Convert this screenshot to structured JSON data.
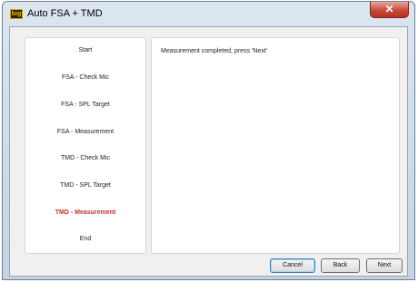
{
  "window": {
    "icon_text": "big",
    "title": "Auto FSA + TMD"
  },
  "steps": [
    {
      "label": "Start",
      "active": false
    },
    {
      "label": "FSA - Check Mic",
      "active": false
    },
    {
      "label": "FSA - SPL Target",
      "active": false
    },
    {
      "label": "FSA - Measurement",
      "active": false
    },
    {
      "label": "TMD - Check Mic",
      "active": false
    },
    {
      "label": "TMD - SPL Target",
      "active": false
    },
    {
      "label": "TMD - Measurement",
      "active": true
    },
    {
      "label": "End",
      "active": false
    }
  ],
  "content": {
    "status": "Measurement completed, press 'Next'"
  },
  "buttons": {
    "cancel": "Cancel",
    "back": "Back",
    "next": "Next"
  },
  "colors": {
    "active_step": "#c8302a",
    "close_button": "#c74a3a"
  }
}
